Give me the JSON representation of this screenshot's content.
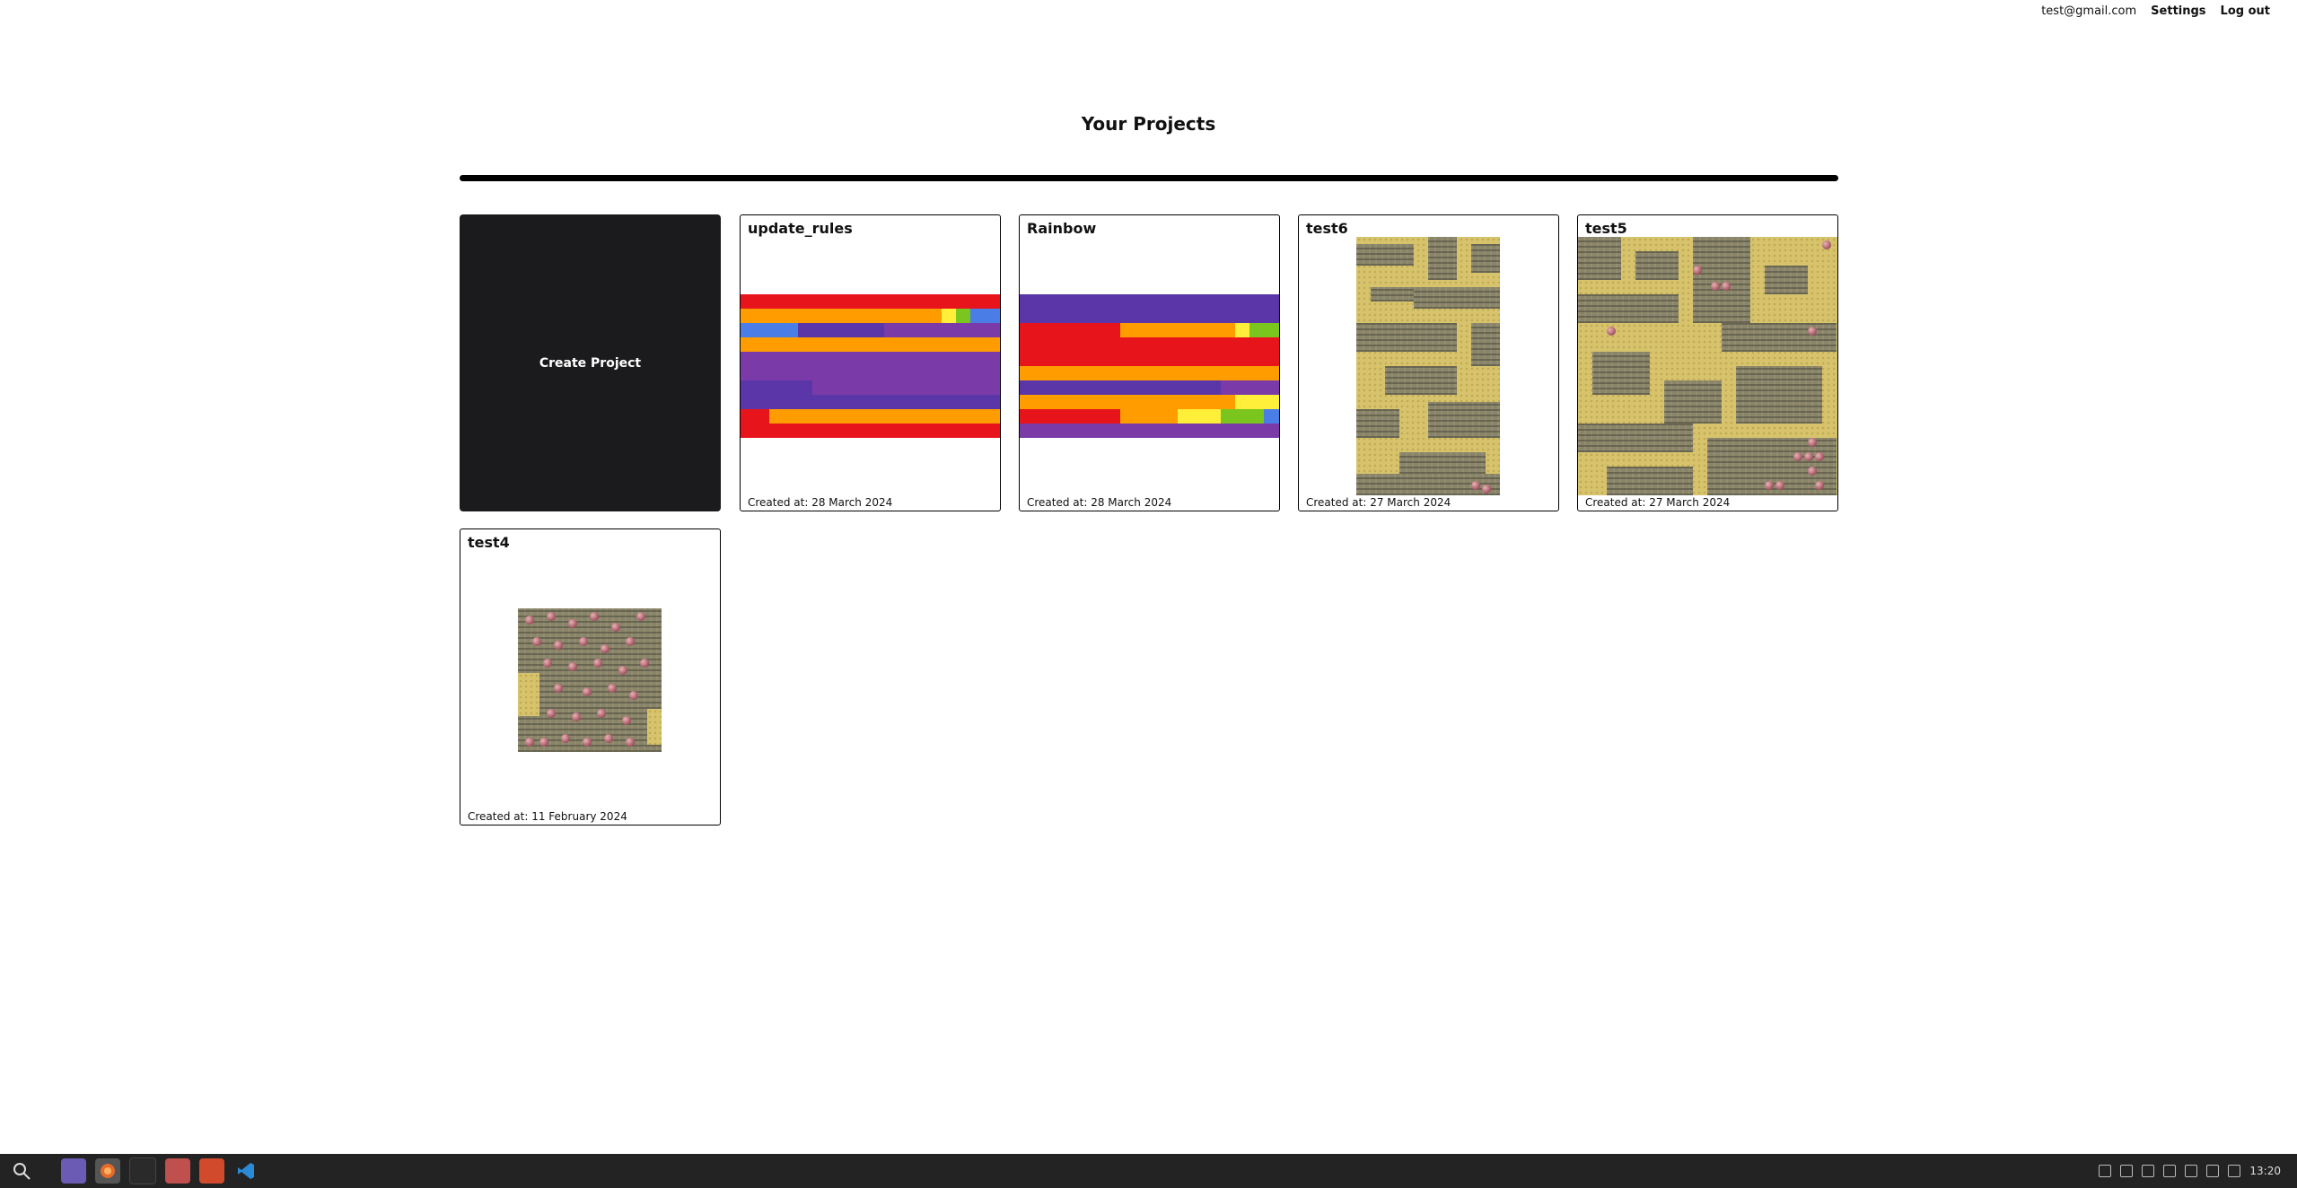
{
  "header": {
    "email": "test@gmail.com",
    "settings_label": "Settings",
    "logout_label": "Log out"
  },
  "page_title": "Your Projects",
  "create_label": "Create Project",
  "projects": [
    {
      "name": "update_rules",
      "created": "Created at: 28 March 2024"
    },
    {
      "name": "Rainbow",
      "created": "Created at: 28 March 2024"
    },
    {
      "name": "test6",
      "created": "Created at: 27 March 2024"
    },
    {
      "name": "test5",
      "created": "Created at: 27 March 2024"
    },
    {
      "name": "test4",
      "created": "Created at: 11 February 2024"
    }
  ],
  "colors": {
    "red": "#e8141c",
    "orange": "#ff9c00",
    "yellow": "#ffee3a",
    "green": "#7ac51e",
    "blue": "#4a7de6",
    "purple": "#5a36a8",
    "violet": "#7a3aa8"
  },
  "taskbar": {
    "icons": [
      "search-icon",
      "files-icon",
      "firefox-icon",
      "terminal-icon",
      "image-viewer-icon",
      "software-icon",
      "vscode-icon"
    ],
    "clock": "13:20"
  }
}
